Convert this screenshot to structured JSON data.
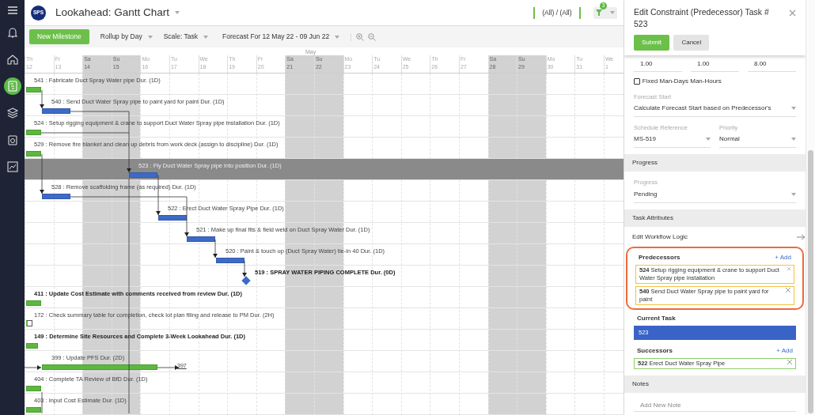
{
  "sidebar": {
    "items": [
      {
        "kind": "bell",
        "selected": false
      },
      {
        "kind": "home",
        "selected": false
      },
      {
        "kind": "gantt",
        "selected": true
      },
      {
        "kind": "layers",
        "selected": false
      },
      {
        "kind": "clipboard",
        "selected": false
      },
      {
        "kind": "chart",
        "selected": false
      }
    ]
  },
  "header": {
    "logo": "SPS",
    "title": "Lookahead: Gantt Chart",
    "scope": "(All) / (All)",
    "filter_count": "3"
  },
  "toolbar": {
    "button": "New Milestone",
    "dropdowns": [
      "Rollup by Day",
      "Scale: Task",
      "Forecast For 12 May 22 - 09 Jun 22"
    ]
  },
  "timeline": {
    "month": "May",
    "days": [
      {
        "weekday": "Th",
        "date": "12",
        "weekend": false
      },
      {
        "weekday": "Fr",
        "date": "13",
        "weekend": false
      },
      {
        "weekday": "Sa",
        "date": "14",
        "weekend": true
      },
      {
        "weekday": "Su",
        "date": "15",
        "weekend": true
      },
      {
        "weekday": "Mo",
        "date": "16",
        "weekend": false
      },
      {
        "weekday": "Tu",
        "date": "17",
        "weekend": false
      },
      {
        "weekday": "We",
        "date": "18",
        "weekend": false
      },
      {
        "weekday": "Th",
        "date": "19",
        "weekend": false
      },
      {
        "weekday": "Fr",
        "date": "20",
        "weekend": false
      },
      {
        "weekday": "Sa",
        "date": "21",
        "weekend": true
      },
      {
        "weekday": "Su",
        "date": "22",
        "weekend": true
      },
      {
        "weekday": "Mo",
        "date": "23",
        "weekend": false
      },
      {
        "weekday": "Tu",
        "date": "24",
        "weekend": false
      },
      {
        "weekday": "We",
        "date": "25",
        "weekend": false
      },
      {
        "weekday": "Th",
        "date": "26",
        "weekend": false
      },
      {
        "weekday": "Fr",
        "date": "27",
        "weekend": false
      },
      {
        "weekday": "Sa",
        "date": "28",
        "weekend": true
      },
      {
        "weekday": "Su",
        "date": "29",
        "weekend": true
      },
      {
        "weekday": "Mo",
        "date": "30",
        "weekend": false
      },
      {
        "weekday": "Tu",
        "date": "31",
        "weekend": false
      },
      {
        "weekday": "We",
        "date": "1",
        "weekend": false
      }
    ]
  },
  "tasks": [
    {
      "label": "541 : Fabricate Duct Spray Water pipe Dur. (1D)",
      "kind": "bar",
      "color": "#5cb83f",
      "bold": false,
      "selected": false
    },
    {
      "label": "540 : Send Duct Water Spray pipe to paint yard for paint Dur. (1D)",
      "kind": "bar",
      "color": "#3d6ac8",
      "bold": false,
      "selected": false
    },
    {
      "label": "524 : Setup rigging equipment & crane to support Duct Water Spray pipe installation Dur. (1D)",
      "kind": "bar",
      "color": "#5cb83f",
      "bold": false,
      "selected": false
    },
    {
      "label": "529 : Remove fire blanket and clean up debris from work deck (assign to discipline) Dur. (1D)",
      "kind": "bar",
      "color": "#5cb83f",
      "bold": false,
      "selected": false
    },
    {
      "label": "523 : Fly Duct Water Spray pipe into position Dur. (1D)",
      "kind": "bar",
      "color": "#3d6ac8",
      "bold": false,
      "selected": true
    },
    {
      "label": "528 : Remove scaffolding frame (as required) Dur. (1D)",
      "kind": "bar",
      "color": "#3d6ac8",
      "bold": false,
      "selected": false
    },
    {
      "label": "522 : Erect Duct Water Spray Pipe Dur. (1D)",
      "kind": "bar",
      "color": "#3d6ac8",
      "bold": false,
      "selected": false
    },
    {
      "label": "521 : Make up final fits & field weld on Duct Spray Water Dur. (1D)",
      "kind": "bar",
      "color": "#3d6ac8",
      "bold": false,
      "selected": false
    },
    {
      "label": "520 : Paint & touch up (Duct Spray Water) tie-in 40 Dur. (1D)",
      "kind": "bar",
      "color": "#3d6ac8",
      "bold": false,
      "selected": false
    },
    {
      "label": "519 : SPRAY WATER PIPING COMPLETE Dur. (0D)",
      "kind": "milestone",
      "color": "#3d6ac8",
      "bold": true,
      "selected": false
    },
    {
      "label": "411 : Update Cost Estimate with comments received from review Dur. (1D)",
      "kind": "bar",
      "color": "#5cb83f",
      "bold": true,
      "selected": false
    },
    {
      "label": "172 : Check summary table for completion, check lot plan filing and release to PM Dur. (2H)",
      "kind": "marker",
      "color": "#5cb83f",
      "bold": false,
      "selected": false
    },
    {
      "label": "149 : Determine Site Resources and Complete 3-Week Lookahead Dur. (1D)",
      "kind": "bar",
      "color": "#5cb83f",
      "bold": true,
      "selected": false
    },
    {
      "label": "399 : Update PFS Dur. (2D)",
      "kind": "bar",
      "color": "#5cb83f",
      "bold": false,
      "selected": false,
      "link": "397"
    },
    {
      "label": "404 : Complete TA Review of BfD Dur. (1D)",
      "kind": "bar",
      "color": "#5cb83f",
      "bold": false,
      "selected": false
    },
    {
      "label": "403 : Input Cost Estimate Dur. (1D)",
      "kind": "bar",
      "color": "#5cb83f",
      "bold": false,
      "selected": false
    }
  ],
  "panel": {
    "title": "Edit Constraint (Predecessor) Task # 523",
    "buttons": [
      "Submit",
      "Cancel"
    ],
    "values": [
      "1.00",
      "1.00",
      "8.00"
    ],
    "fixed_checkbox": {
      "label": "Fixed Man-Days Man-Hours",
      "checked": false
    },
    "forecast_start": {
      "label": "Forecast Start",
      "value": "Calculate Forecast Start based on Predecessor's"
    },
    "schedule_reference": {
      "label": "Schedule Reference",
      "value": "MS-519"
    },
    "priority": {
      "label": "Priority",
      "value": "Normal"
    },
    "progress_section": "Progress",
    "progress": {
      "label": "Progress",
      "value": "Pending"
    },
    "attributes_section": "Task Attributes",
    "workflow_link": "Edit Workflow Logic",
    "predecessors": {
      "title": "Predecessors",
      "add": "+ Add",
      "items": [
        "**524** Setup rigging equipment & crane to support Duct Water Spray pipe installation",
        "**540** Send Duct Water Spray pipe to paint yard for paint"
      ]
    },
    "current_task": {
      "title": "Current Task",
      "value": "523"
    },
    "successors": {
      "title": "Successors",
      "add": "+ Add",
      "items": [
        "**522** Erect Duct Water Spray Pipe"
      ]
    },
    "notes_section": "Notes",
    "note": {
      "placeholder": "Add New Note"
    }
  }
}
